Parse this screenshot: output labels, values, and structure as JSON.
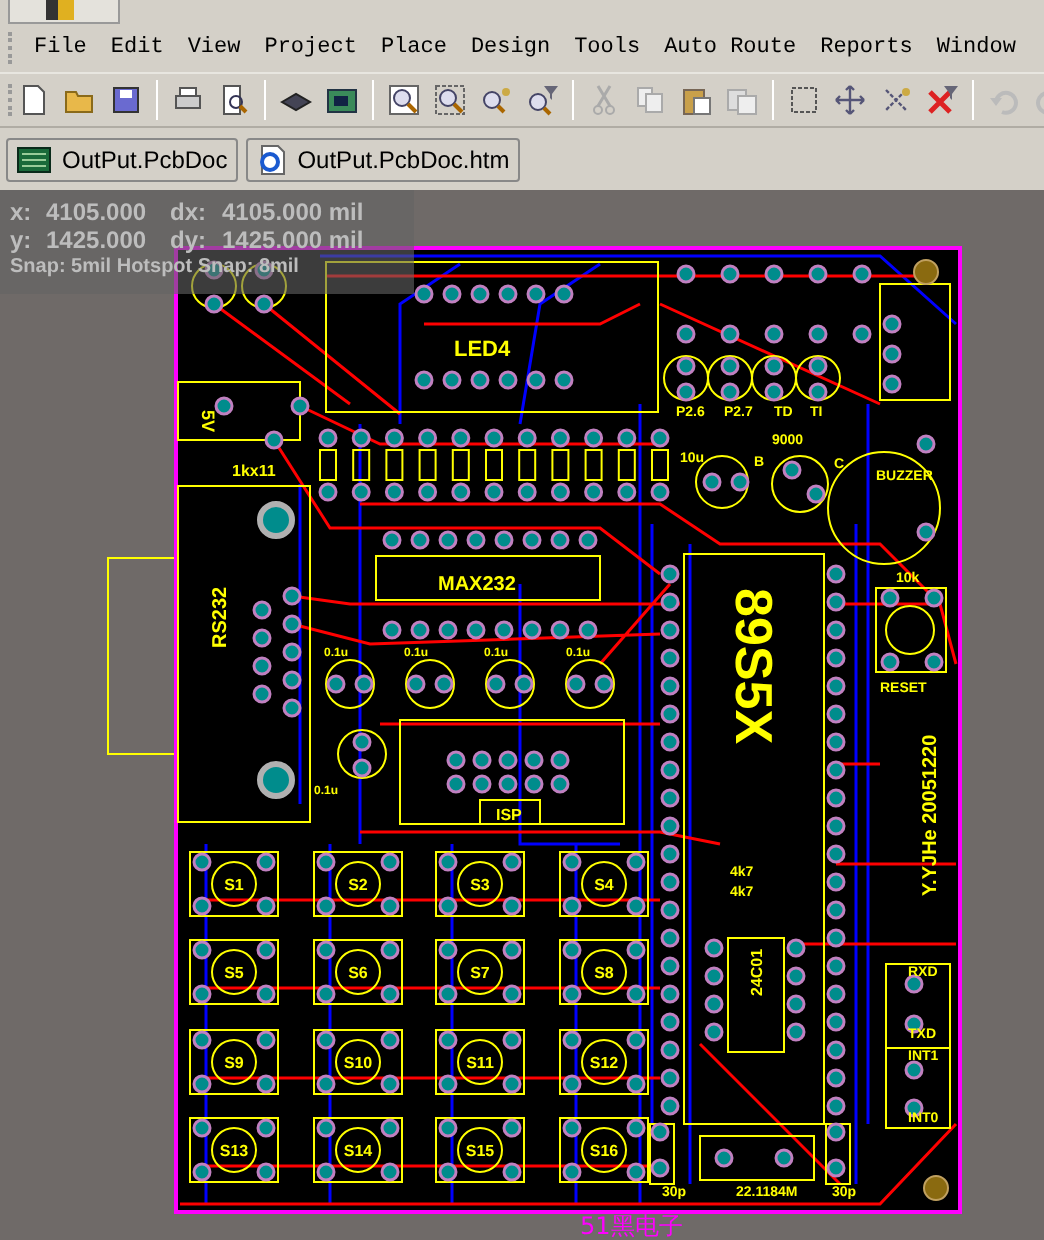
{
  "menu": [
    "File",
    "Edit",
    "View",
    "Project",
    "Place",
    "Design",
    "Tools",
    "Auto Route",
    "Reports",
    "Window"
  ],
  "documents": [
    {
      "label": "OutPut.PcbDoc",
      "kind": "pcb"
    },
    {
      "label": "OutPut.PcbDoc.htm",
      "kind": "html"
    }
  ],
  "readout": {
    "lines": [
      {
        "label": "x:",
        "value": "4105.000",
        "delta_label": "dx:",
        "delta_value": "4105.000 mil"
      },
      {
        "label": "y:",
        "value": "1425.000",
        "delta_label": "dy:",
        "delta_value": "1425.000 mil"
      }
    ],
    "snap": "Snap: 5mil Hotspot Snap: 8mil"
  },
  "board": {
    "labels": [
      {
        "text": "LED4"
      },
      {
        "text": "5V"
      },
      {
        "text": "1kx11"
      },
      {
        "text": "P2.6"
      },
      {
        "text": "P2.7"
      },
      {
        "text": "TD"
      },
      {
        "text": "TI"
      },
      {
        "text": "9000"
      },
      {
        "text": "10u"
      },
      {
        "text": "B"
      },
      {
        "text": "C"
      },
      {
        "text": "BUZZER"
      },
      {
        "text": "10k"
      },
      {
        "text": "MAX232"
      },
      {
        "text": "RS232"
      },
      {
        "text": "0.1u"
      },
      {
        "text": "0.1u"
      },
      {
        "text": "0.1u"
      },
      {
        "text": "0.1u"
      },
      {
        "text": "0.1u"
      },
      {
        "text": "ISP"
      },
      {
        "text": "RESET"
      },
      {
        "text": "89S5X"
      },
      {
        "text": "Y.YJHe 20051220"
      },
      {
        "text": "4k7"
      },
      {
        "text": "4k7"
      },
      {
        "text": "24C01"
      },
      {
        "text": "RXD"
      },
      {
        "text": "TXD"
      },
      {
        "text": "INT1"
      },
      {
        "text": "INT0"
      },
      {
        "text": "30p"
      },
      {
        "text": "22.1184M"
      },
      {
        "text": "30p"
      }
    ],
    "switches": [
      "S1",
      "S2",
      "S3",
      "S4",
      "S5",
      "S6",
      "S7",
      "S8",
      "S9",
      "S10",
      "S11",
      "S12",
      "S13",
      "S14",
      "S15",
      "S16"
    ],
    "caption": "51黑电子"
  }
}
